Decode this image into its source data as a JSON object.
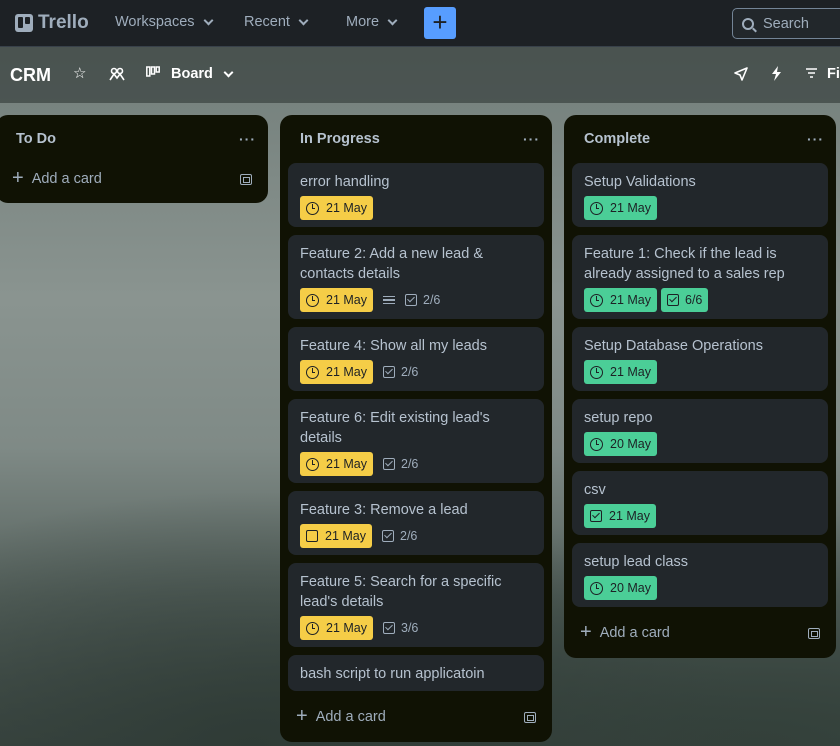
{
  "topbar": {
    "logo": "Trello",
    "nav": [
      "Workspaces",
      "Recent",
      "More"
    ],
    "create_label": "+",
    "search_placeholder": "Search"
  },
  "board": {
    "title": "CRM",
    "view": "Board",
    "filter_label": "Fi"
  },
  "colors": {
    "due_yellow": "#f5cd47",
    "due_green": "#4bce97",
    "create_blue": "#579dff"
  },
  "lists": [
    {
      "title": "To Do",
      "cards": [],
      "add_label": "Add a card"
    },
    {
      "title": "In Progress",
      "cards": [
        {
          "title": "error handling",
          "due": "21 May",
          "due_style": "yellow"
        },
        {
          "title": "Feature 2: Add a new lead & contacts details",
          "due": "21 May",
          "due_style": "yellow",
          "has_description": true,
          "checklist": "2/6"
        },
        {
          "title": "Feature 4: Show all my leads",
          "due": "21 May",
          "due_style": "yellow",
          "checklist": "2/6"
        },
        {
          "title": "Feature 6: Edit existing lead's details",
          "due": "21 May",
          "due_style": "yellow",
          "checklist": "2/6"
        },
        {
          "title": "Feature 3: Remove a lead",
          "due": "21 May",
          "due_style": "yellow",
          "due_icon": "checkbox",
          "checklist": "2/6"
        },
        {
          "title": "Feature 5: Search for a specific lead's details",
          "due": "21 May",
          "due_style": "yellow",
          "checklist": "3/6"
        },
        {
          "title": "bash script to run applicatoin"
        }
      ],
      "add_label": "Add a card"
    },
    {
      "title": "Complete",
      "cards": [
        {
          "title": "Setup Validations",
          "due": "21 May",
          "due_style": "green"
        },
        {
          "title": "Feature 1: Check if the lead is already assigned to a sales rep",
          "due": "21 May",
          "due_style": "green",
          "checklist": "6/6",
          "checklist_complete": true
        },
        {
          "title": "Setup Database Operations",
          "due": "21 May",
          "due_style": "green"
        },
        {
          "title": "setup repo",
          "due": "20 May",
          "due_style": "green"
        },
        {
          "title": "csv",
          "due": "21 May",
          "due_style": "green",
          "due_icon": "checked"
        },
        {
          "title": "setup lead class",
          "due": "20 May",
          "due_style": "green"
        }
      ],
      "add_label": "Add a card"
    }
  ]
}
